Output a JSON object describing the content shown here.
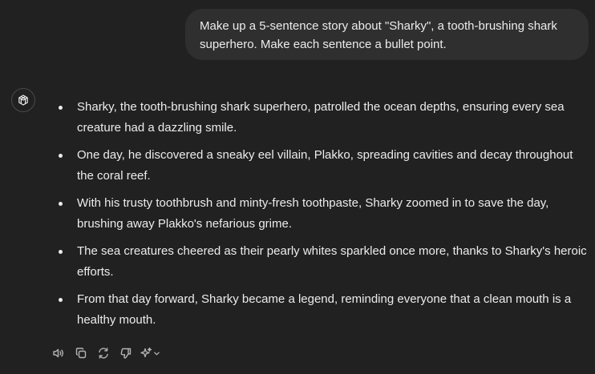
{
  "user_message": {
    "text": "Make up a 5-sentence story about \"Sharky\", a tooth-brushing shark superhero. Make each sentence a bullet point."
  },
  "assistant": {
    "avatar_icon": "openai-logo-icon",
    "bullets": [
      "Sharky, the tooth-brushing shark superhero, patrolled the ocean depths, ensuring every sea creature had a dazzling smile.",
      "One day, he discovered a sneaky eel villain, Plakko, spreading cavities and decay throughout the coral reef.",
      "With his trusty toothbrush and minty-fresh toothpaste, Sharky zoomed in to save the day, brushing away Plakko's nefarious grime.",
      "The sea creatures cheered as their pearly whites sparkled once more, thanks to Sharky's heroic efforts.",
      "From that day forward, Sharky became a legend, reminding everyone that a clean mouth is a healthy mouth."
    ]
  },
  "action_bar": {
    "icons": [
      "speaker-icon",
      "copy-icon",
      "regenerate-icon",
      "thumbs-down-icon",
      "sparkle-icon",
      "chevron-down-icon"
    ]
  },
  "colors": {
    "background": "#212121",
    "user_bubble": "#2f2f2f",
    "text": "#ececec",
    "icon": "#b4b4b4"
  }
}
